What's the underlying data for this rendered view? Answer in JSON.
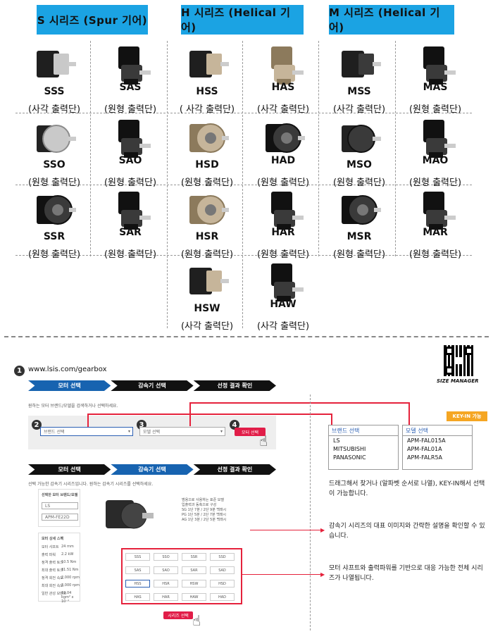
{
  "headers": [
    {
      "label": "S 시리즈 (Spur 기어)"
    },
    {
      "label": "H 시리즈 (Helical 기어)"
    },
    {
      "label": "M 시리즈 (Helical 기어)"
    }
  ],
  "grid": [
    {
      "code": "SSS",
      "desc": "(사각 출력단)",
      "color": "silver",
      "kind": "square"
    },
    {
      "code": "SAS",
      "desc": "(원형 출력단)",
      "color": "dark",
      "kind": "angle"
    },
    {
      "code": "HSS",
      "desc": "( 사각 출력단)",
      "color": "bronze",
      "kind": "square"
    },
    {
      "code": "HAS",
      "desc": "(사각 출력단)",
      "color": "bronze",
      "kind": "angle"
    },
    {
      "code": "MSS",
      "desc": "(사각 출력단)",
      "color": "dark",
      "kind": "square"
    },
    {
      "code": "MAS",
      "desc": "(원형 출력단)",
      "color": "dark",
      "kind": "angle"
    },
    {
      "code": "SSO",
      "desc": "(원형 출력단)",
      "color": "silver",
      "kind": "round"
    },
    {
      "code": "SAO",
      "desc": "(원형 출력단)",
      "color": "dark",
      "kind": "angle"
    },
    {
      "code": "HSD",
      "desc": "(원형 출력단)",
      "color": "bronze",
      "kind": "flange"
    },
    {
      "code": "HAD",
      "desc": "(원형 출력단)",
      "color": "dark",
      "kind": "flange"
    },
    {
      "code": "MSO",
      "desc": "(원형 출력단)",
      "color": "dark",
      "kind": "round"
    },
    {
      "code": "MAO",
      "desc": "(원형 출력단)",
      "color": "dark",
      "kind": "angle"
    },
    {
      "code": "SSR",
      "desc": "(원형 출력단)",
      "color": "dark",
      "kind": "flange"
    },
    {
      "code": "SAR",
      "desc": "(원형 출력단)",
      "color": "dark",
      "kind": "angle"
    },
    {
      "code": "HSR",
      "desc": "(원형 출력단)",
      "color": "bronze",
      "kind": "flange"
    },
    {
      "code": "HAR",
      "desc": "(원형 출력단)",
      "color": "dark",
      "kind": "angle"
    },
    {
      "code": "MSR",
      "desc": "(원형 출력단)",
      "color": "dark",
      "kind": "flange"
    },
    {
      "code": "MAR",
      "desc": "(원형 출력단)",
      "color": "dark",
      "kind": "angle"
    },
    {
      "code": "HSW",
      "desc": "(사각 출력단)",
      "color": "bronze",
      "kind": "square"
    },
    {
      "code": "HAW",
      "desc": "(사각 출력단)",
      "color": "dark",
      "kind": "angle"
    }
  ],
  "guide": {
    "step_no": "1",
    "url": "www.lsis.com/gearbox",
    "qr_caption": "SIZE MANAGER",
    "steps": [
      "모터 선택",
      "감속기 선택",
      "선정 결과 확인"
    ],
    "intro": "원하는 모터 브랜드/모델을 검색하거나 선택하세요.",
    "badge2": "2",
    "badge3": "3",
    "badge4": "4",
    "brand_select": "브랜드 선택",
    "model_select": "모델 선택",
    "motor_btn": "모터 선택",
    "key_in": "KEY-IN 가능",
    "brand_panel": {
      "title": "브랜드 선택",
      "items": [
        "LS",
        "MITSUBISHI",
        "PANASONIC"
      ]
    },
    "model_panel": {
      "title": "모델 선택",
      "items": [
        "APM-FAL015A",
        "APM-FAL01A",
        "APM-FALR5A"
      ]
    },
    "note1": "드래그해서 찾거나 (알파벳 순서로 나열), KEY-IN해서 선택이 가능합니다.",
    "note2": "감속기 시리즈의 대표 이미지와 간략한 설명을 확인할 수 있습니다.",
    "note3": "모터 샤프트와 출력파워를 기반으로 대응 가능한 전체 시리즈가 나열됩니다.",
    "screen2_intro": "선택 가능한 감속기 시리즈입니다. 원하는 감속기 시리즈를 선택하세요.",
    "selected_title": "선택한 모터 브랜드/모델",
    "selected_brand": "LS",
    "selected_model": "APM-FE22D",
    "spec_title": "모터 상세 스펙",
    "specs": [
      {
        "k": "모터 샤프트",
        "v": "24 mm"
      },
      {
        "k": "출력 파워",
        "v": "2.2 kW"
      },
      {
        "k": "정격 출력 토크",
        "v": "10.5 Nm"
      },
      {
        "k": "최대 출력 토크",
        "v": "31.51 Nm"
      },
      {
        "k": "정격 회전 속도",
        "v": "2,000 rpm"
      },
      {
        "k": "최대 회전 속도",
        "v": "3,000 rpm"
      },
      {
        "k": "일반 관성 모멘트",
        "v": "19.04 kgm² x 10⁻⁴"
      }
    ],
    "series_desc": [
      "범용으로 사용하는 표준 모델",
      "입출력과 동축으로 구성",
      "SG 1단 7분 / 2단 9분 백래시",
      "PG 1단 5분 / 2단 7분 백래시",
      "AG 1단 3분 / 2단 5분 백래시"
    ],
    "series_buttons": [
      "SSS",
      "SSO",
      "SSR",
      "SSD",
      "SAS",
      "SAO",
      "SAR",
      "SAD",
      "HSS",
      "HSR",
      "HSW",
      "HSD",
      "HAS",
      "HAR",
      "HAW",
      "HAD"
    ],
    "series_btn": "시리즈 선택"
  },
  "colors": {
    "header_bg": "#1ba3e3",
    "accent_red": "#e5223c",
    "step_active": "#1763b0",
    "key_in_bg": "#f5a623"
  }
}
